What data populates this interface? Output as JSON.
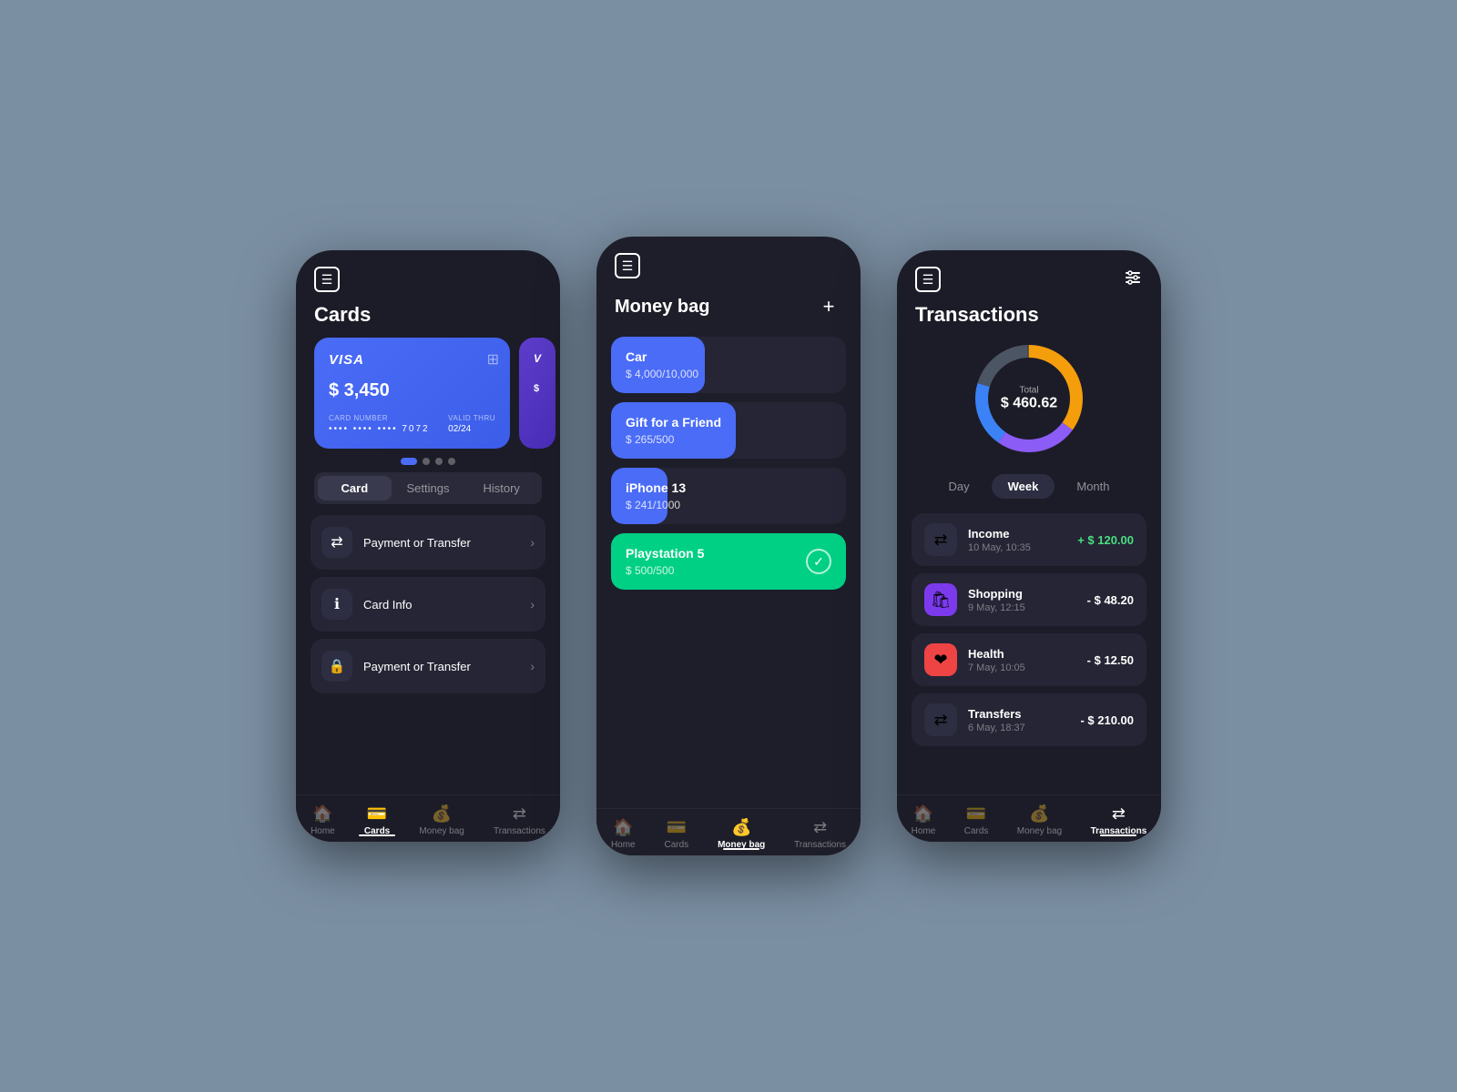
{
  "phone1": {
    "title": "Cards",
    "card": {
      "brand": "VISA",
      "balance": "$ 3,450",
      "card_number_masked": "•••• •••• •••• 7072",
      "valid_thru": "02/24",
      "card_number_label": "CARD NUMBER",
      "valid_label": "VALID THRU"
    },
    "tabs": [
      "Card",
      "Settings",
      "History"
    ],
    "active_tab": 0,
    "menu_items": [
      {
        "icon": "⇄",
        "label": "Payment or Transfer"
      },
      {
        "icon": "ℹ",
        "label": "Card Info"
      },
      {
        "icon": "🔒",
        "label": "Payment or Transfer"
      }
    ],
    "nav": [
      {
        "icon": "🏠",
        "label": "Home",
        "active": false
      },
      {
        "icon": "💳",
        "label": "Cards",
        "active": true
      },
      {
        "icon": "💰",
        "label": "Money bag",
        "active": false
      },
      {
        "icon": "⇄",
        "label": "Transactions",
        "active": false
      }
    ]
  },
  "phone2": {
    "title": "Money bag",
    "savings": [
      {
        "name": "Car",
        "current": 4000,
        "total": 10000,
        "label": "$ 4,000/10,000",
        "color": "#4a6cf7",
        "progress": 40
      },
      {
        "name": "Gift for a Friend",
        "current": 265,
        "total": 500,
        "label": "$ 265/500",
        "color": "#4a6cf7",
        "progress": 53
      },
      {
        "name": "iPhone 13",
        "current": 241,
        "total": 1000,
        "label": "$ 241/1000",
        "color": "#4a6cf7",
        "progress": 24
      },
      {
        "name": "Playstation 5",
        "current": 500,
        "total": 500,
        "label": "$ 500/500",
        "color": "#00d084",
        "progress": 100
      }
    ],
    "nav": [
      {
        "icon": "🏠",
        "label": "Home",
        "active": false
      },
      {
        "icon": "💳",
        "label": "Cards",
        "active": false
      },
      {
        "icon": "💰",
        "label": "Money bag",
        "active": true
      },
      {
        "icon": "⇄",
        "label": "Transactions",
        "active": false
      }
    ]
  },
  "phone3": {
    "title": "Transactions",
    "total_label": "Total",
    "total_value": "$ 460.62",
    "period_tabs": [
      "Day",
      "Week",
      "Month"
    ],
    "active_period": 1,
    "donut": {
      "segments": [
        {
          "color": "#f59e0b",
          "value": 35
        },
        {
          "color": "#8b5cf6",
          "value": 25
        },
        {
          "color": "#3b82f6",
          "value": 20
        },
        {
          "color": "#6b7280",
          "value": 20
        }
      ]
    },
    "transactions": [
      {
        "name": "Income",
        "date": "10 May, 10:35",
        "amount": "+ $ 120.00",
        "type": "income",
        "icon": "⇄",
        "bg": "#2e2e42"
      },
      {
        "name": "Shopping",
        "date": "9 May, 12:15",
        "amount": "- $ 48.20",
        "type": "expense",
        "icon": "🛍",
        "bg": "#7c3aed"
      },
      {
        "name": "Health",
        "date": "7 May, 10:05",
        "amount": "- $ 12.50",
        "type": "expense",
        "icon": "❤",
        "bg": "#ef4444"
      },
      {
        "name": "Transfers",
        "date": "6 May, 18:37",
        "amount": "- $ 210.00",
        "type": "expense",
        "icon": "⇄",
        "bg": "#2e2e42"
      }
    ],
    "nav": [
      {
        "icon": "🏠",
        "label": "Home",
        "active": false
      },
      {
        "icon": "💳",
        "label": "Cards",
        "active": false
      },
      {
        "icon": "💰",
        "label": "Money bag",
        "active": false
      },
      {
        "icon": "⇄",
        "label": "Transactions",
        "active": true
      }
    ]
  }
}
